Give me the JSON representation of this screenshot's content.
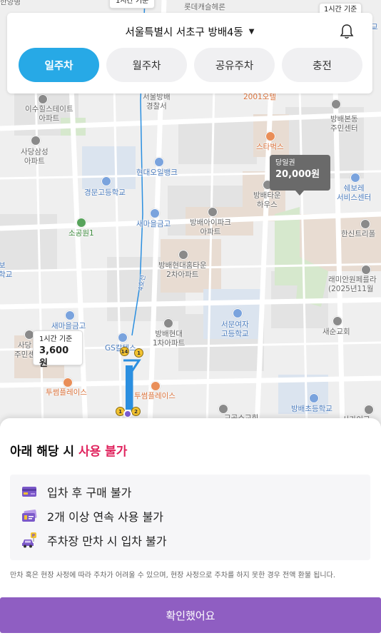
{
  "header": {
    "location": "서울특별시 서초구 방배4동",
    "tabs": [
      {
        "label": "일주차",
        "active": true
      },
      {
        "label": "월주차",
        "active": false
      },
      {
        "label": "공유주차",
        "active": false
      },
      {
        "label": "충전",
        "active": false
      }
    ]
  },
  "map": {
    "labels": {
      "top_left": "한양병",
      "top_center_bubble": "1시간 기준",
      "lotte": "롯데캐슬헤론",
      "top_right_bubble": "1시간 기준",
      "top_right_edge": "교",
      "station": "서울방배\n경찰서",
      "hotel": "2001오텔",
      "isu": "이수힐스테이트\n아파트",
      "samsung": "사당삼성\n아파트",
      "starbucks": "스타벅스",
      "hyundai_oil": "현대오일뱅크",
      "kyungmoon": "경문고등학교",
      "bangbae_center": "방배본동\n주민센터",
      "bangbae_town": "방배타운\n하우스",
      "shvore": "쉐보레\n서비스센터",
      "park1": "소공원1",
      "saemaul1": "새마을금고",
      "ipark": "방배아이파크\n아파트",
      "hansin": "한신트리폴",
      "left_edge": "보\n학교",
      "heights": "방배현대홈타운\n2차아파트",
      "lemian": "래미안원페를라\n(2025년11월",
      "road": "4호선",
      "saemaul2": "새마을금고",
      "seomun": "서문여자\n고등학교",
      "saesoon": "새순교회",
      "sadang_center": "사당\n주민센",
      "gs": "GS칼텍스",
      "hyundai1": "방배현대\n1차아파트",
      "twosome1": "투썸플레이스",
      "twosome2": "투썸플레이스",
      "bangbae_elem": "방배초등학교",
      "bottom1": "교공소교회",
      "bottom2": "사가이교"
    },
    "markers": {
      "daily": {
        "label": "당일권",
        "price": "20,000원"
      },
      "hourly": {
        "label": "1시간 기준",
        "price": "3,600원"
      }
    },
    "route_pins": [
      "14",
      "1",
      "1",
      "2"
    ]
  },
  "sheet": {
    "title_prefix": "아래 해당 시 ",
    "title_accent": "사용 불가",
    "rules": [
      {
        "icon": "credit-card-icon",
        "text": "입차 후 구매 불가"
      },
      {
        "icon": "ticket-icon",
        "text": "2개 이상 연속 사용 불가"
      },
      {
        "icon": "parking-car-icon",
        "text": "주차장 만차 시 입차 불가"
      }
    ],
    "notice": "만차 혹은 현장 사정에 따라 주차가 어려울 수 있으며, 현장 사정으로 주차를 하지 못한 경우 전액 환불 됩니다.",
    "confirm_label": "확인했어요"
  },
  "colors": {
    "tab_active": "#27a9e6",
    "accent_red": "#e0245e",
    "confirm": "#8f5ec2",
    "route": "#2b8fe0"
  }
}
